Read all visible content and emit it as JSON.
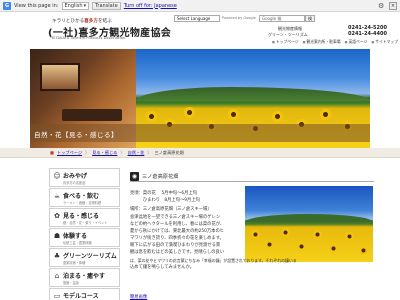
{
  "translate_bar": {
    "logo": "G",
    "view_text": "View this page in:",
    "language": "English",
    "translate_button": "Translate",
    "turn_off": "Turn off for: Japanese",
    "close": "×",
    "options": "⚙"
  },
  "header": {
    "slogan_pre": "キラリとひかる",
    "slogan_mid": "喜多方",
    "slogan_post": "を結ぶ",
    "org_name": "(一社)喜多方観光物産協会",
    "org_en": "KITAKATA Tourism Products Association",
    "lang_select": "Select Language",
    "powered_by": "Powered by Google",
    "search_placeholder": "Google 検",
    "search_btn": "検",
    "tel1_label": "観光物産情報",
    "tel1_num": "0241-24-5200",
    "tel2_label": "グリーン・ツーリズム",
    "tel2_num": "0241-24-4400",
    "links": [
      "トップページ",
      "観光案内所・駐車場",
      "英語ページ",
      "サイトマップ"
    ]
  },
  "hero": {
    "caption": "自然・花【見る・感じる】"
  },
  "breadcrumb": {
    "home": "トップページ",
    "items": [
      "見る・感じる",
      "自然・花",
      "三ノ倉高原花畑"
    ],
    "separator": "〉"
  },
  "sidebar": {
    "items": [
      {
        "icon": "☺",
        "icon_name": "smile-icon",
        "title": "おみやげ",
        "sub": "喜多方の名産品"
      },
      {
        "icon": "☕",
        "icon_name": "cup-icon",
        "title": "食べる・飲む",
        "sub": "ラーメン・酒蔵・名物料理"
      },
      {
        "icon": "✿",
        "icon_name": "flower-icon",
        "title": "見る・感じる",
        "sub": "蔵・自然・花・祭り・イベント"
      },
      {
        "icon": "☗",
        "icon_name": "house-icon",
        "title": "体験する",
        "sub": "伝統工芸・農業体験"
      },
      {
        "icon": "♣",
        "icon_name": "clover-icon",
        "title": "グリーンツーリズム",
        "sub": "農家民宿・体験"
      },
      {
        "icon": "⌂",
        "icon_name": "inn-icon",
        "title": "泊まる・癒やす",
        "sub": "旅館・温泉"
      },
      {
        "icon": "▭",
        "icon_name": "course-icon",
        "title": "モデルコース",
        "sub": ""
      }
    ]
  },
  "content": {
    "title": "三ノ倉高原花畑",
    "lines": [
      "見頃：菜の花　 5月中旬～6月上旬",
      "　　　ひまわり　8月上旬～9月上旬",
      "場所：三ノ倉高原花畑（三ノ倉スキー場）",
      "会津盆地を一望できる三ノ倉スキー場のゲレン",
      "などの約ヘクタールを利用し、春には菜の花が、",
      "夏から秋にかけては、東北最大の約250万本のヒ",
      "マワリが咲き誇り、四季折々の花を楽しめます。",
      "眼下に広がる田ので満喫ひまわりが見渡せる景",
      "観は息を飲むほどの美しさです。見晴らしの良い",
      "は、菜の花やヒマワリの花言葉にちなみ「幸福の鐘」が設置されております。それぞれの鐘いる",
      "込めて鐘を鳴らしてみませんか。"
    ],
    "link": "簡易画像"
  }
}
